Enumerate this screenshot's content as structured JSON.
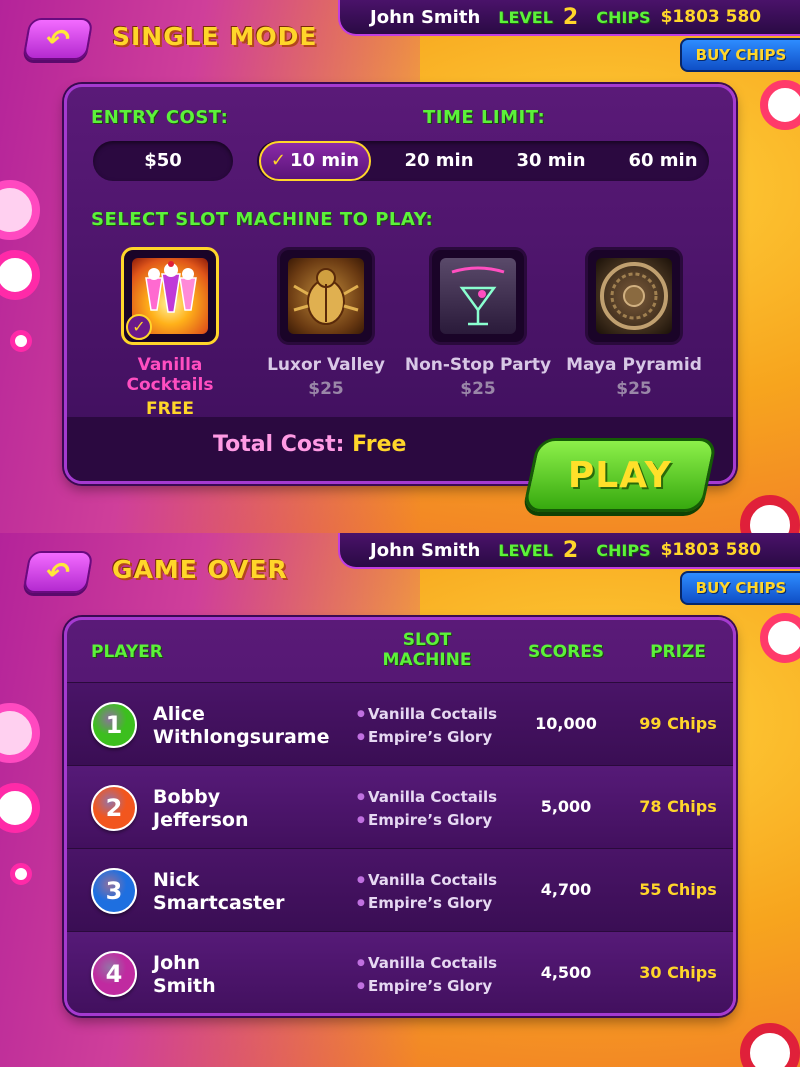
{
  "user": {
    "name": "John Smith",
    "level_label": "LEVEL",
    "level": "2",
    "chips_label": "CHIPS",
    "chips": "$1803 580"
  },
  "buy_chips": "BUY CHIPS",
  "single_mode": {
    "title": "SINGLE MODE",
    "entry_cost_label": "ENTRY COST:",
    "entry_cost": "$50",
    "time_limit_label": "TIME LIMIT:",
    "time_options": [
      "10 min",
      "20 min",
      "30 min",
      "60 min"
    ],
    "selected_time": "10 min",
    "check_glyph": "✓",
    "select_label": "SELECT SLOT MACHINE TO PLAY:",
    "slots": [
      {
        "name": "Vanilla Cocktails",
        "price": "FREE",
        "icon": "cocktails-icon"
      },
      {
        "name": "Luxor Valley",
        "price": "$25",
        "icon": "scarab-icon"
      },
      {
        "name": "Non-Stop Party",
        "price": "$25",
        "icon": "party-icon"
      },
      {
        "name": "Maya Pyramid",
        "price": "$25",
        "icon": "maya-calendar-icon"
      }
    ],
    "total_label": "Total Cost:",
    "total_value": "Free",
    "play": "PLAY"
  },
  "game_over": {
    "title": "GAME OVER",
    "headers": {
      "player": "PLAYER",
      "slot_machine_1": "SLOT",
      "slot_machine_2": "MACHINE",
      "scores": "SCORES",
      "prize": "PRIZE"
    },
    "rows": [
      {
        "rank": "1",
        "first": "Alice",
        "last": "Withlongsurame",
        "slot1": "Vanilla Coctails",
        "slot2": "Empire’s Glory",
        "score": "10,000",
        "prize": "99 Chips",
        "color": "#3cbf1e"
      },
      {
        "rank": "2",
        "first": "Bobby",
        "last": "Jefferson",
        "slot1": "Vanilla Coctails",
        "slot2": "Empire’s Glory",
        "score": "5,000",
        "prize": "78 Chips",
        "color": "#f2561e"
      },
      {
        "rank": "3",
        "first": "Nick",
        "last": "Smartcaster",
        "slot1": "Vanilla Coctails",
        "slot2": "Empire’s Glory",
        "score": "4,700",
        "prize": "55 Chips",
        "color": "#1e6fe0"
      },
      {
        "rank": "4",
        "first": "John",
        "last": "Smith",
        "slot1": "Vanilla Coctails",
        "slot2": "Empire’s Glory",
        "score": "4,500",
        "prize": "30 Chips",
        "color": "#c02aa0"
      }
    ]
  },
  "colors": {
    "accent_green": "#5cf23a",
    "gold": "#ffd62a",
    "panel": "#4a1468",
    "pink": "#ff4ec0"
  }
}
